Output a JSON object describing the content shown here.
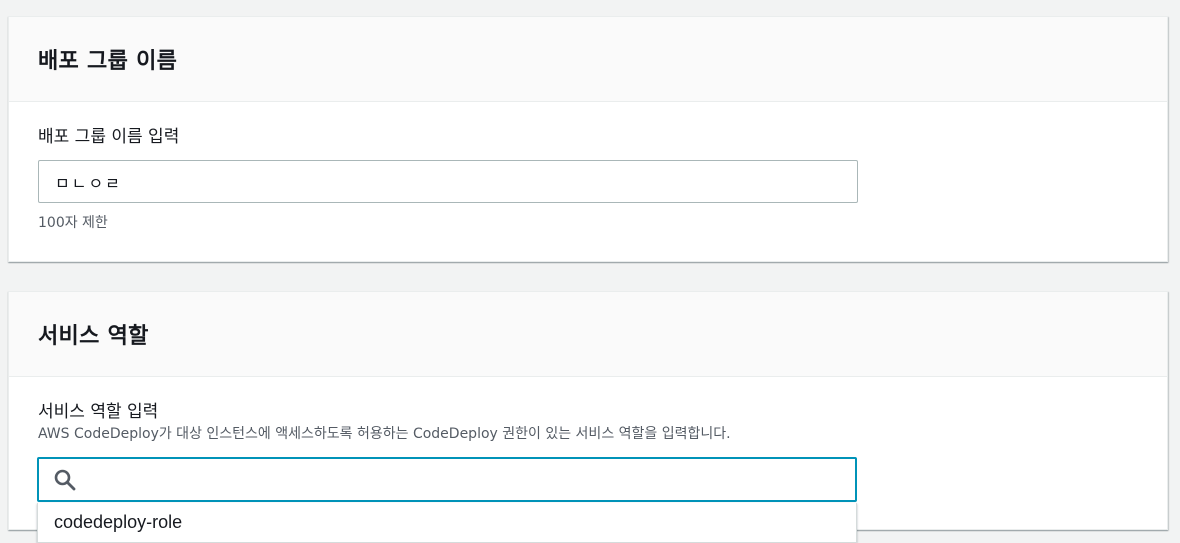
{
  "deployment_group": {
    "title": "배포 그룹 이름",
    "label": "배포 그룹 이름 입력",
    "value": "ㅁㄴㅇㄹ",
    "hint": "100자 제한"
  },
  "service_role": {
    "title": "서비스 역할",
    "label": "서비스 역할 입력",
    "description": "AWS CodeDeploy가 대상 인스턴스에 액세스하도록 허용하는 CodeDeploy 권한이 있는 서비스 역할을 입력합니다.",
    "search_value": "",
    "options": [
      "codedeploy-role"
    ]
  },
  "colors": {
    "focus_border": "#0093b8",
    "input_border": "#aab7b8",
    "header_bg": "#fafafa",
    "page_bg": "#f2f3f3"
  }
}
